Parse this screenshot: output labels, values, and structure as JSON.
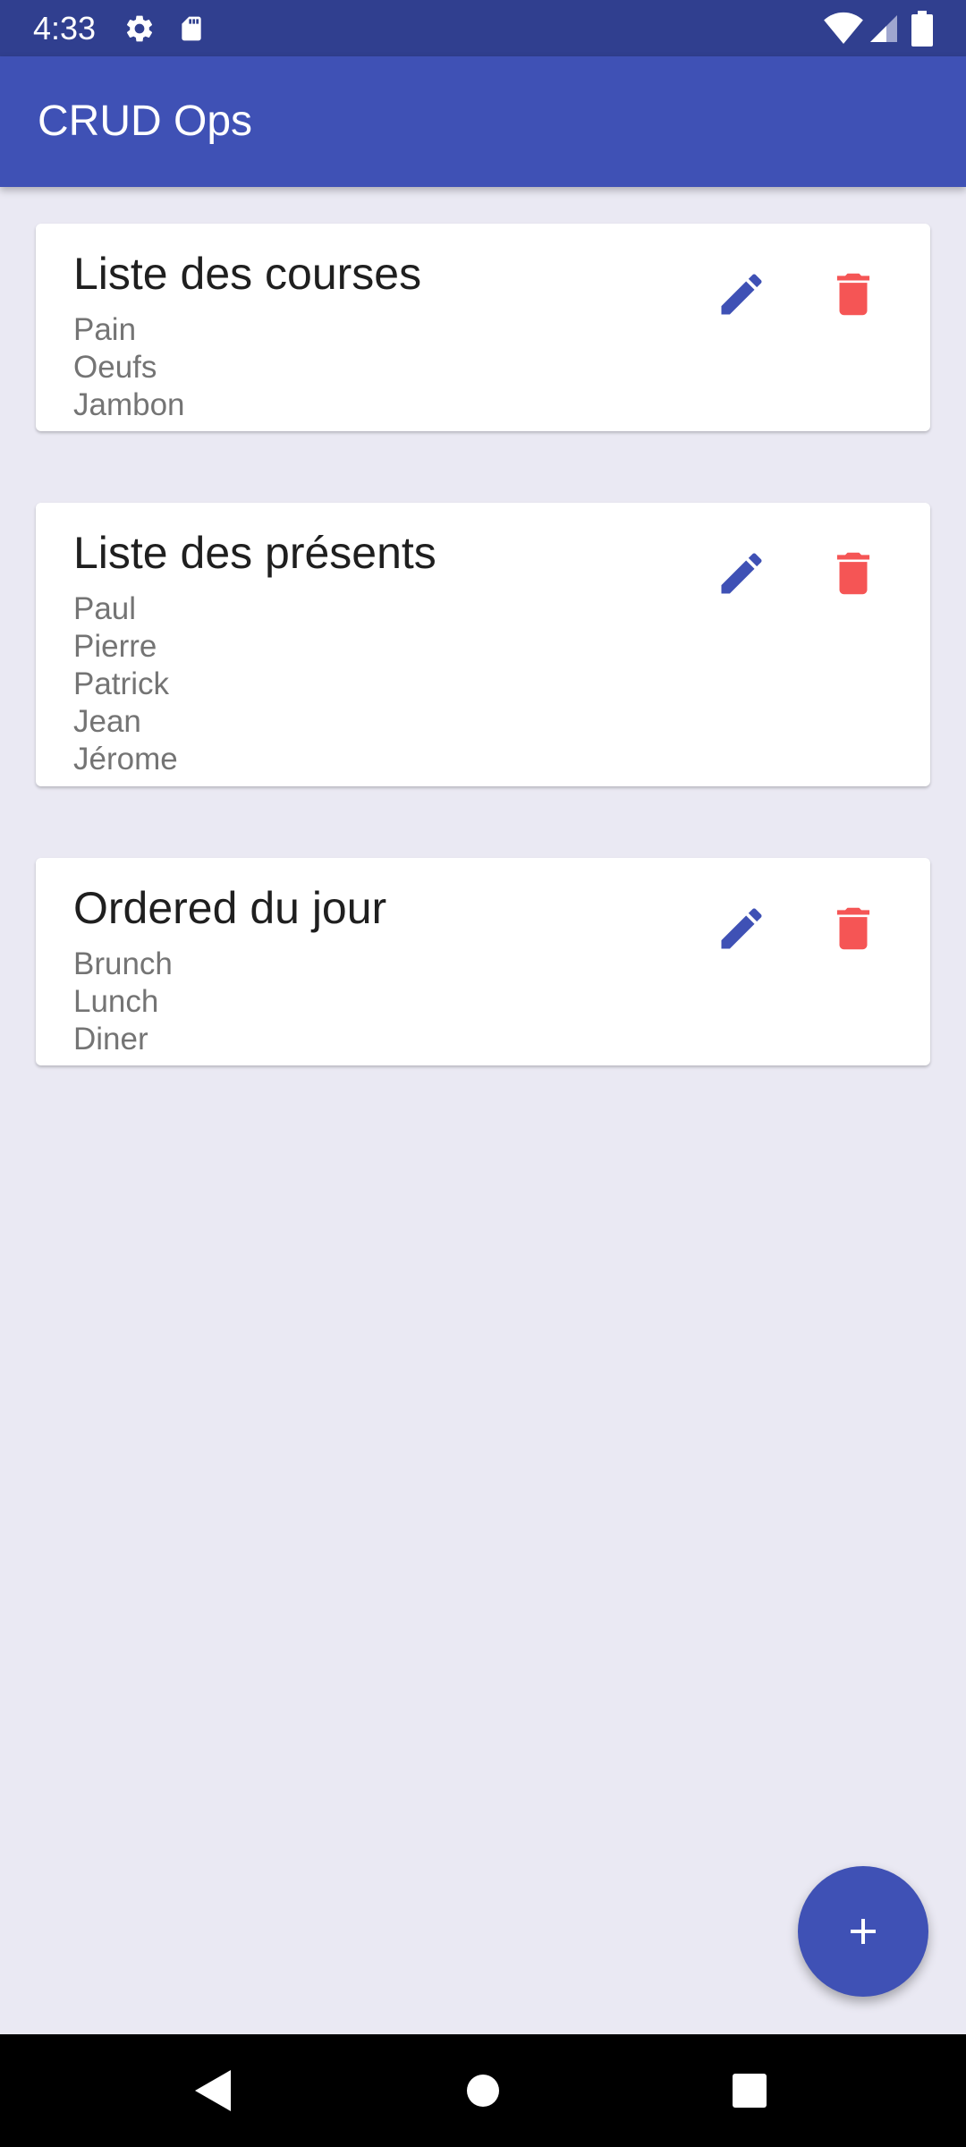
{
  "status_bar": {
    "time": "4:33",
    "icons": [
      "gear-icon",
      "sd-card-icon",
      "wifi-icon",
      "cell-signal-icon",
      "battery-icon"
    ]
  },
  "app_bar": {
    "title": "CRUD Ops"
  },
  "lists": [
    {
      "title": "Liste des courses",
      "items": [
        "Pain",
        "Oeufs",
        "Jambon"
      ]
    },
    {
      "title": "Liste des présents",
      "items": [
        "Paul",
        "Pierre",
        "Patrick",
        "Jean",
        "Jérome"
      ]
    },
    {
      "title": "Ordered du jour",
      "items": [
        "Brunch",
        "Lunch",
        "Diner"
      ]
    }
  ],
  "card_actions": {
    "edit_icon": "pencil-icon",
    "delete_icon": "trash-icon"
  },
  "fab": {
    "icon": "plus-icon"
  },
  "nav_bar": {
    "icons": [
      "back-icon",
      "home-icon",
      "recents-icon"
    ]
  },
  "colors": {
    "primary": "#3F51B5",
    "primary_dark": "#303F8F",
    "background": "#EAE9F3",
    "delete": "#F55555",
    "subtitle_text": "#747474"
  }
}
